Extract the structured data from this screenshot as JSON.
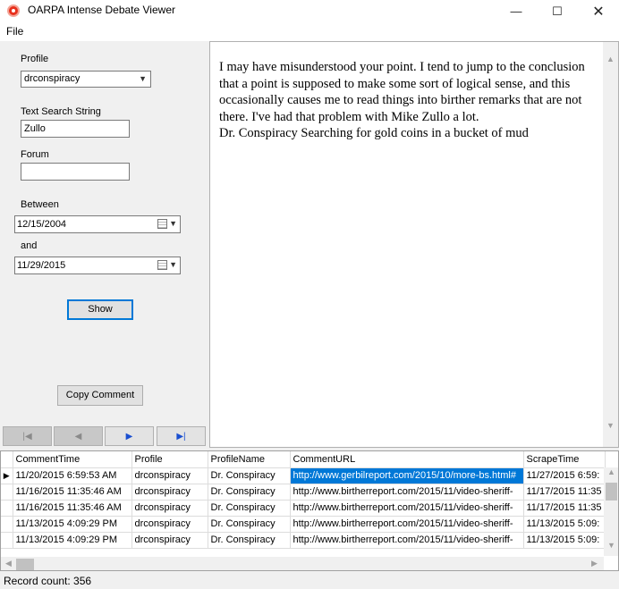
{
  "window": {
    "title": "OARPA Intense Debate Viewer",
    "min_glyph": "—",
    "max_glyph": "☐",
    "close_glyph": "✕"
  },
  "menu": {
    "file": "File"
  },
  "form": {
    "profile_label": "Profile",
    "profile_value": "drconspiracy",
    "search_label": "Text Search String",
    "search_value": "Zullo",
    "forum_label": "Forum",
    "forum_value": "",
    "between_label": "Between",
    "start_date": "12/15/2004",
    "and_label": "and",
    "end_date": "11/29/2015",
    "show_button": "Show",
    "copy_button": "Copy Comment"
  },
  "nav": {
    "first": "|◀",
    "prev": "◀",
    "next": "▶",
    "last": "▶|"
  },
  "comment": {
    "body": "I may have misunderstood your point. I tend to jump to the conclusion that a point is supposed to make some sort of logical sense, and this occasionally causes me to read things into birther remarks that are not there. I've had that problem with Mike Zullo a lot.",
    "signature": "Dr. Conspiracy Searching for gold coins in a bucket of mud"
  },
  "grid": {
    "columns": [
      "CommentTime",
      "Profile",
      "ProfileName",
      "CommentURL",
      "ScrapeTime"
    ],
    "rows": [
      [
        "11/20/2015 6:59:53 AM",
        "drconspiracy",
        "Dr. Conspiracy",
        "http://www.gerbilreport.com/2015/10/more-bs.html#",
        "11/27/2015 6:59:"
      ],
      [
        "11/16/2015 11:35:46 AM",
        "drconspiracy",
        "Dr. Conspiracy",
        "http://www.birtherreport.com/2015/11/video-sheriff-",
        "11/17/2015 11:35"
      ],
      [
        "11/16/2015 11:35:46 AM",
        "drconspiracy",
        "Dr. Conspiracy",
        "http://www.birtherreport.com/2015/11/video-sheriff-",
        "11/17/2015 11:35"
      ],
      [
        "11/13/2015 4:09:29 PM",
        "drconspiracy",
        "Dr. Conspiracy",
        "http://www.birtherreport.com/2015/11/video-sheriff-",
        "11/13/2015 5:09:"
      ],
      [
        "11/13/2015 4:09:29 PM",
        "drconspiracy",
        "Dr. Conspiracy",
        "http://www.birtherreport.com/2015/11/video-sheriff-",
        "11/13/2015 5:09:"
      ]
    ],
    "current_row_marker": "▶"
  },
  "status": {
    "record_count": "Record count: 356"
  }
}
